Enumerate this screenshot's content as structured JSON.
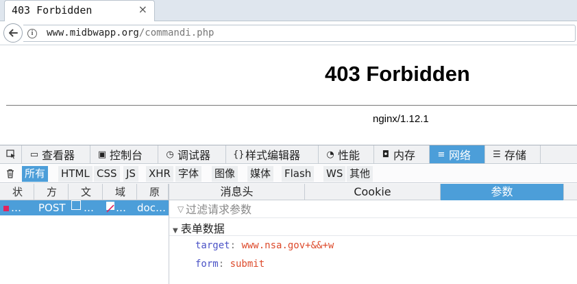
{
  "browser": {
    "tab_title": "403 Forbidden",
    "tab_close": "×",
    "url_host": "www.midbwapp.org",
    "url_path": "/commandi.php"
  },
  "page": {
    "heading": "403 Forbidden",
    "server_signature": "nginx/1.12.1"
  },
  "devtools": {
    "tabs": [
      {
        "icon": "inspector-icon",
        "label": "查看器"
      },
      {
        "icon": "console-icon",
        "label": "控制台"
      },
      {
        "icon": "debugger-icon",
        "label": "调试器"
      },
      {
        "icon": "style-editor-icon",
        "label": "样式编辑器"
      },
      {
        "icon": "performance-icon",
        "label": "性能"
      },
      {
        "icon": "memory-icon",
        "label": "内存"
      },
      {
        "icon": "network-icon",
        "label": "网络",
        "active": true
      },
      {
        "icon": "storage-icon",
        "label": "存储"
      }
    ],
    "filters": [
      "所有",
      "HTML",
      "CSS",
      "JS",
      "XHR",
      "字体",
      "图像",
      "媒体",
      "Flash",
      "WS",
      "其他"
    ],
    "active_filter": "所有",
    "columns": [
      "状",
      "方",
      "文",
      "域",
      "原"
    ],
    "request": {
      "status": "…",
      "method": "POST",
      "file": "…",
      "domain": "…",
      "cause": "doc…"
    },
    "side_tabs": [
      "消息头",
      "Cookie",
      "参数"
    ],
    "active_side_tab": "参数",
    "param_filter_placeholder": "过滤请求参数",
    "form_section_title": "表单数据",
    "form_data": [
      {
        "key": "target",
        "value": "www.nsa.gov+&&+w"
      },
      {
        "key": "form",
        "value": "submit"
      }
    ],
    "colors": {
      "accent": "#4c9ed9",
      "status_marker": "#e0245e",
      "param_key": "#4a52c6",
      "param_value": "#dd4a2b"
    }
  }
}
